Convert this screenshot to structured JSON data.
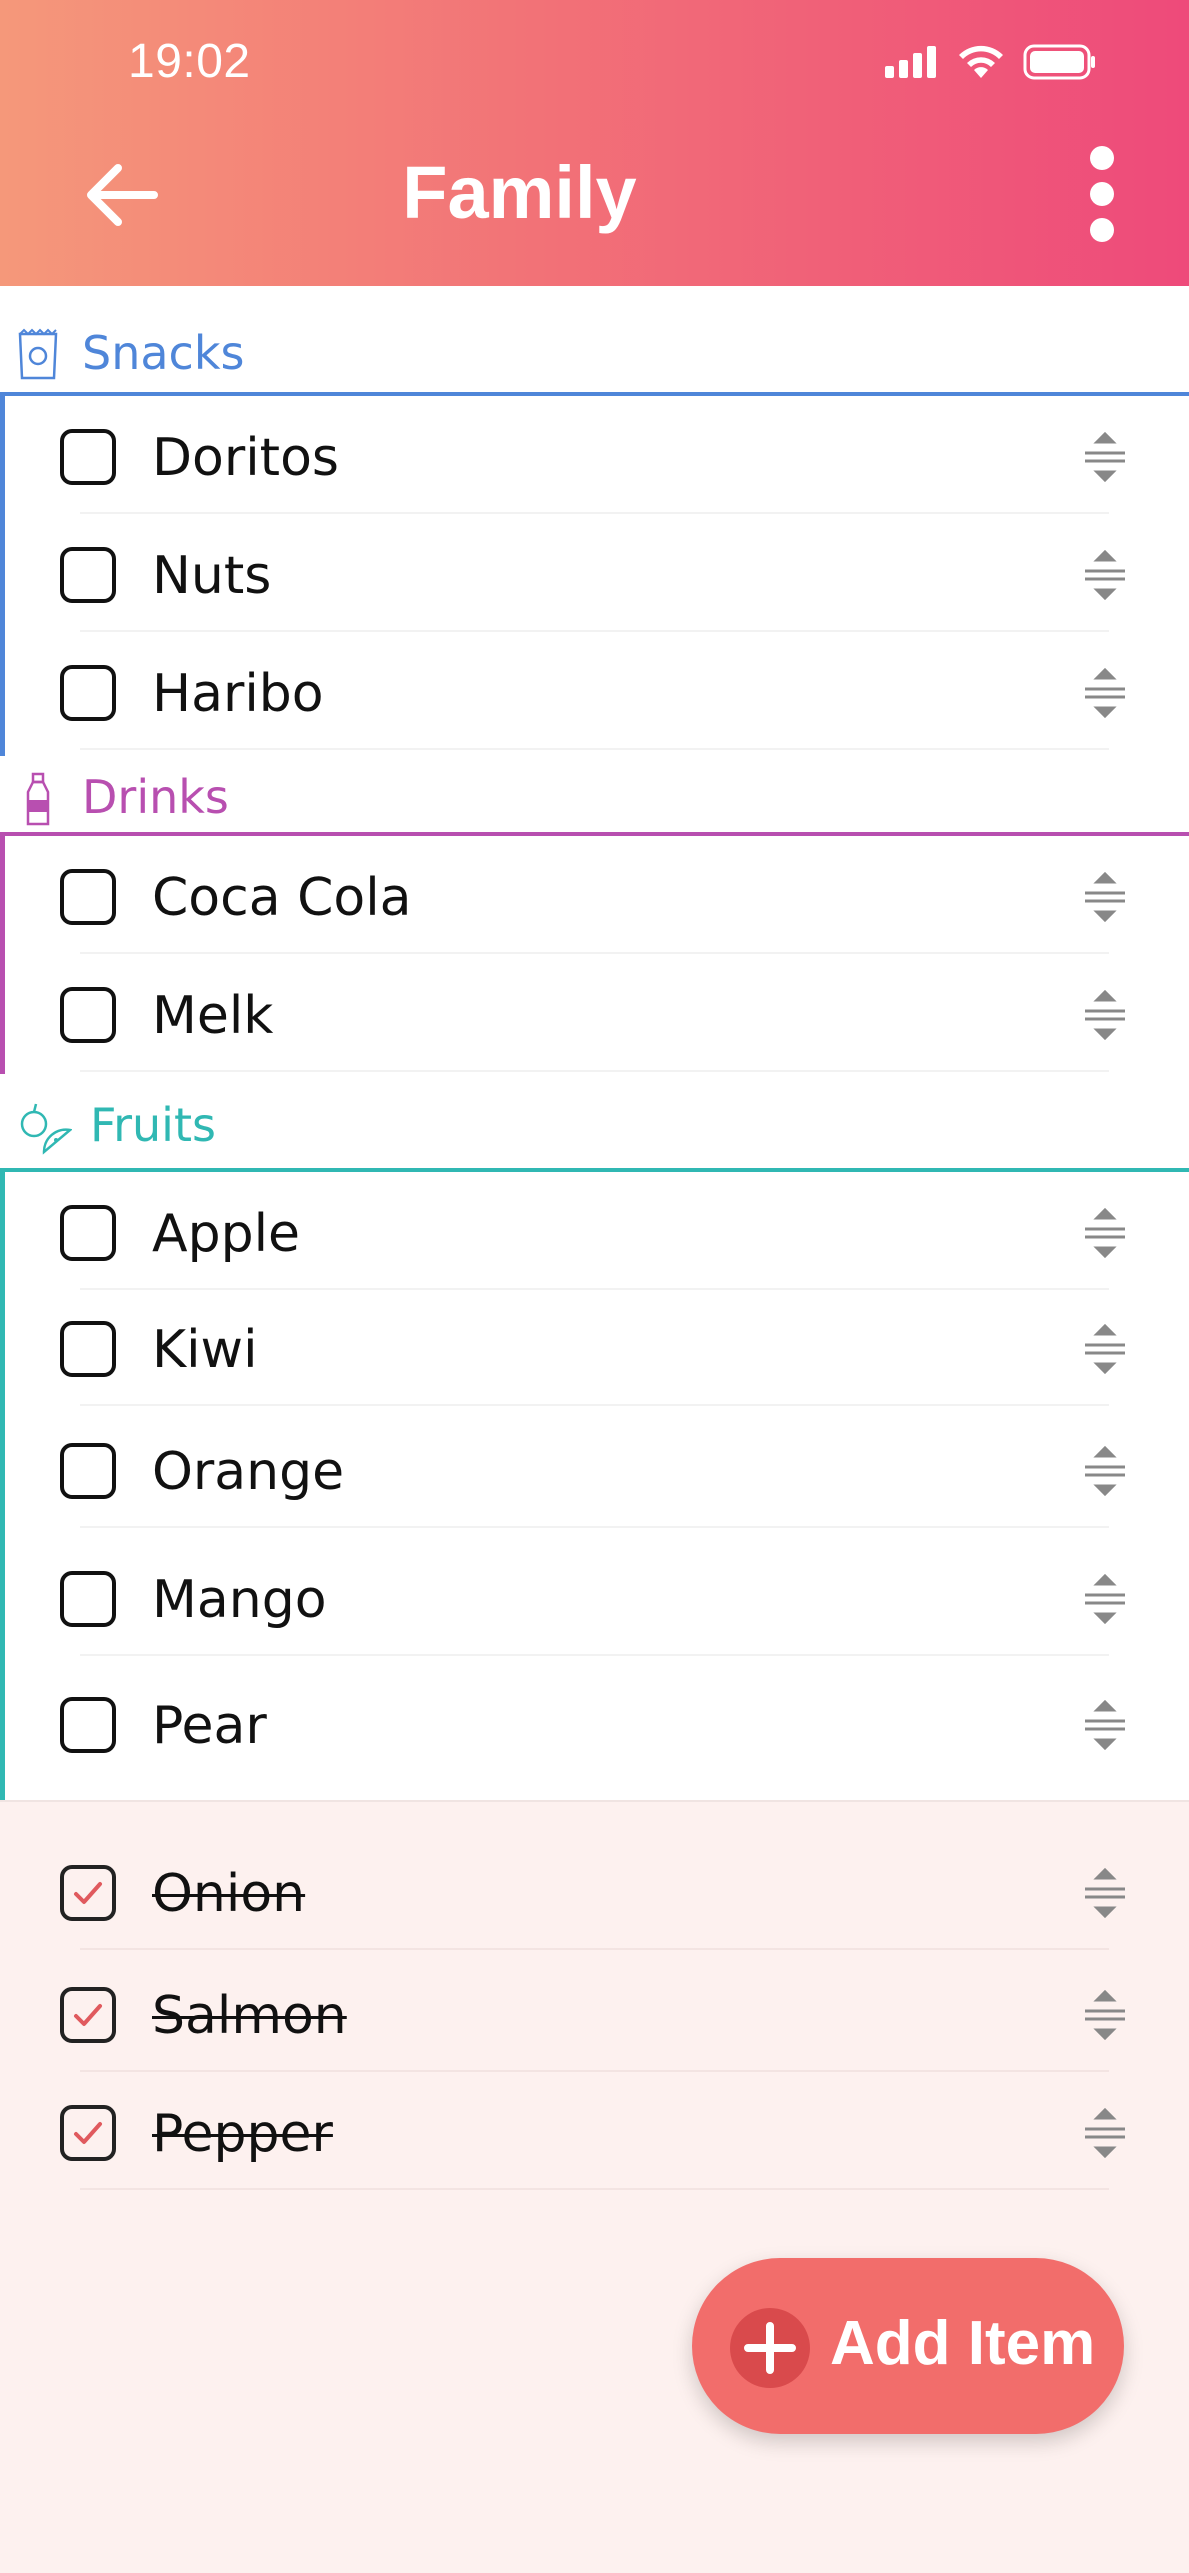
{
  "status_bar": {
    "time": "19:02"
  },
  "header": {
    "title": "Family"
  },
  "categories": [
    {
      "name": "Snacks",
      "color": "#4f86d9",
      "icon": "chips-bag-icon",
      "items": [
        "Doritos",
        "Nuts",
        "Haribo"
      ]
    },
    {
      "name": "Drinks",
      "color": "#b84fb0",
      "icon": "bottle-icon",
      "items": [
        "Coca Cola",
        "Melk"
      ]
    },
    {
      "name": "Fruits",
      "color": "#30b8b3",
      "icon": "fruits-icon",
      "items": [
        "Apple",
        "Kiwi",
        "Orange",
        "Mango",
        "Pear"
      ]
    }
  ],
  "completed_items": [
    "Onion",
    "Salmon",
    "Pepper"
  ],
  "fab": {
    "label": "Add Item"
  },
  "colors": {
    "accent": "#f26d6b",
    "check": "#e05a5e"
  }
}
